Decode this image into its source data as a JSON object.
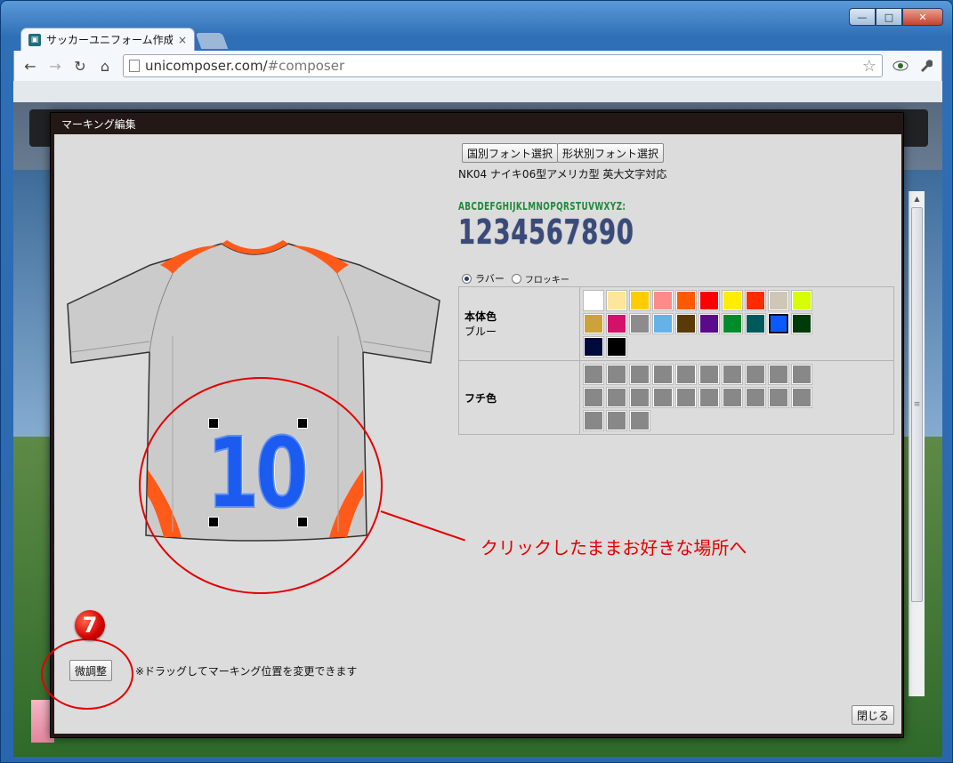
{
  "browser": {
    "tab_title": "サッカーユニフォーム作成",
    "tab_close": "×",
    "url_host": "unicomposer.com/",
    "url_rest": "#composer",
    "back": "←",
    "forward": "→",
    "reload": "↻",
    "home": "⌂",
    "window_buttons": {
      "minimize": "—",
      "maximize": "□",
      "close": "✕"
    }
  },
  "modal": {
    "title": "マーキング編集",
    "font_buttons": {
      "country": "国別フォント選択",
      "shape": "形状別フォント選択"
    },
    "font_description": "NK04 ナイキ06型アメリカ型 英大文字対応",
    "font_sample_alpha": "ABCDEFGHIJKLMNOPQRSTUVWXYZ:",
    "font_sample_digits": "1234567890",
    "material": {
      "rubber": "ラバー",
      "flocky": "フロッキー",
      "selected": "rubber"
    },
    "body_color": {
      "label": "本体色",
      "selected_name": "ブルー",
      "swatches": [
        "#ffffff",
        "#fde59a",
        "#ffcc00",
        "#ff8a8a",
        "#ff5a00",
        "#ff0000",
        "#ffee00",
        "#ff2a00",
        "#cfc6b6",
        "#d6ff00",
        "#cca23a",
        "#d4106a",
        "#8c8c8c",
        "#66b2e8",
        "#5a3a08",
        "#5a0a8c",
        "#008c2a",
        "#005a5a",
        "#0a5aff",
        "#003a0a",
        "#000a3a",
        "#000000"
      ],
      "selected_index": 18
    },
    "edge_color": {
      "label": "フチ色",
      "swatches": [
        "#888888",
        "#888888",
        "#888888",
        "#888888",
        "#888888",
        "#888888",
        "#888888",
        "#888888",
        "#888888",
        "#888888",
        "#888888",
        "#888888",
        "#888888",
        "#888888",
        "#888888",
        "#888888",
        "#888888",
        "#888888",
        "#888888",
        "#888888",
        "#888888",
        "#888888",
        "#888888"
      ]
    },
    "jersey_number": "10",
    "annotation": "クリックしたままお好きな場所へ",
    "step_number": "7",
    "fine_adjust_label": "微調整",
    "drag_hint": "※ドラッグしてマーキング位置を変更できます",
    "close_label": "閉じる"
  },
  "colors": {
    "accent_red": "#e40000",
    "number_blue": "#1b5bf0",
    "shirt_gray": "#c9c9c9",
    "shirt_orange": "#ff5a1a"
  }
}
